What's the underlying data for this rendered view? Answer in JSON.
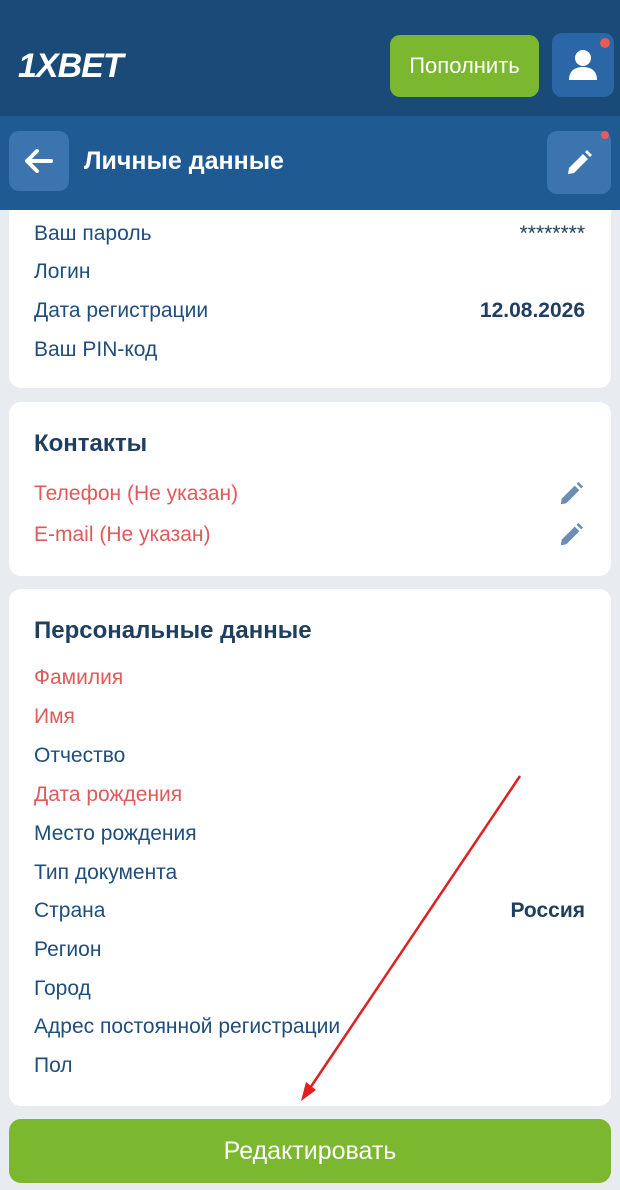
{
  "header": {
    "logo_num": "1X",
    "logo_text": "BET",
    "deposit_label": "Пополнить"
  },
  "subheader": {
    "title": "Личные данные"
  },
  "account": {
    "rows": [
      {
        "label": "Ваш пароль",
        "value": "********"
      },
      {
        "label": "Логин",
        "value": ""
      },
      {
        "label": "Дата регистрации",
        "value": "12.08.2026"
      },
      {
        "label": "Ваш PIN-код",
        "value": ""
      }
    ]
  },
  "contacts": {
    "title": "Контакты",
    "rows": [
      {
        "label": "Телефон (Не указан)"
      },
      {
        "label": "E-mail (Не указан)"
      }
    ]
  },
  "personal": {
    "title": "Персональные данные",
    "rows": [
      {
        "label": "Фамилия",
        "value": "",
        "required": true
      },
      {
        "label": "Имя",
        "value": "",
        "required": true
      },
      {
        "label": "Отчество",
        "value": "",
        "required": false
      },
      {
        "label": "Дата рождения",
        "value": "",
        "required": true
      },
      {
        "label": "Место рождения",
        "value": "",
        "required": false
      },
      {
        "label": "Тип документа",
        "value": "",
        "required": false
      },
      {
        "label": "Страна",
        "value": "Россия",
        "required": false
      },
      {
        "label": "Регион",
        "value": "",
        "required": false
      },
      {
        "label": "Город",
        "value": "",
        "required": false
      },
      {
        "label": "Адрес постоянной регистрации",
        "value": "",
        "required": false
      },
      {
        "label": "Пол",
        "value": "",
        "required": false
      }
    ]
  },
  "footer": {
    "edit_label": "Редактировать"
  },
  "colors": {
    "header_bg": "#1a4a78",
    "accent_green": "#7cb82f",
    "required_red": "#e05a5a",
    "label_blue": "#1f4d7c"
  },
  "icons": {
    "profile": "user-icon",
    "back": "arrow-left-icon",
    "edit": "pencil-icon"
  }
}
